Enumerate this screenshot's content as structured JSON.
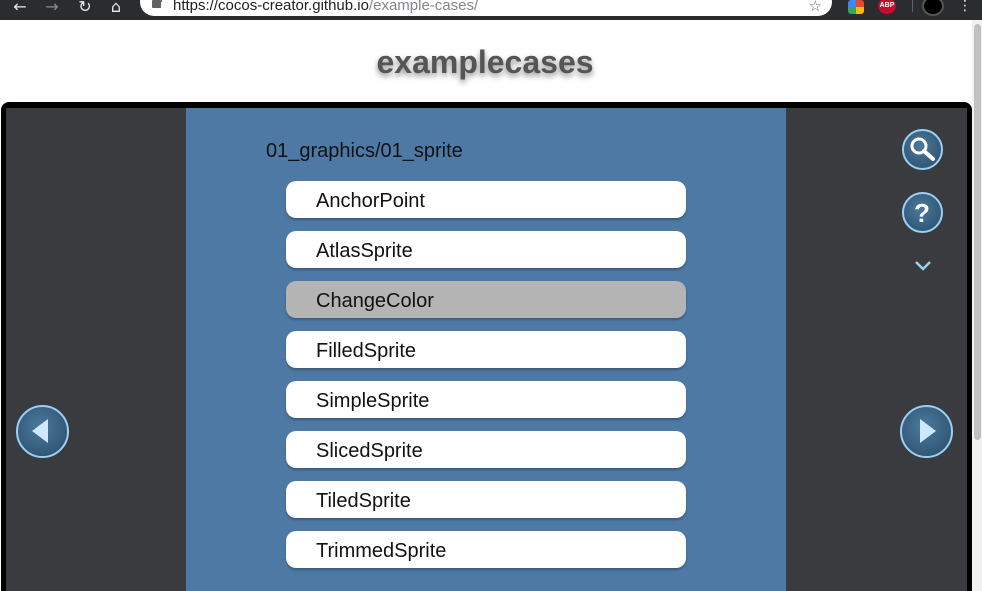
{
  "browser": {
    "url_host": "https://cocos-creator.github.io",
    "url_path": "/example-cases/",
    "back_glyph": "←",
    "forward_glyph": "→",
    "reload_glyph": "↻",
    "home_glyph": "⌂",
    "star_glyph": "☆",
    "abp_label": "ABP",
    "menu_glyph": "⋮"
  },
  "page": {
    "title": "examplecases"
  },
  "list": {
    "section_title": "01_graphics/01_sprite",
    "items": [
      {
        "label": "AnchorPoint",
        "selected": false
      },
      {
        "label": "AtlasSprite",
        "selected": false
      },
      {
        "label": "ChangeColor",
        "selected": true
      },
      {
        "label": "FilledSprite",
        "selected": false
      },
      {
        "label": "SimpleSprite",
        "selected": false
      },
      {
        "label": "SlicedSprite",
        "selected": false
      },
      {
        "label": "TiledSprite",
        "selected": false
      },
      {
        "label": "TrimmedSprite",
        "selected": false
      }
    ]
  },
  "controls": {
    "search_icon": "search-icon",
    "help_icon": "help-icon",
    "help_glyph": "?",
    "expand_icon": "chevron-down-icon",
    "prev_icon": "prev-arrow-icon",
    "next_icon": "next-arrow-icon"
  },
  "colors": {
    "panel": "#4e79a4",
    "background": "#3a3b3f",
    "item": "#ffffff",
    "item_selected": "#b4b4b4",
    "icon_ring": "#9ad0f5"
  }
}
